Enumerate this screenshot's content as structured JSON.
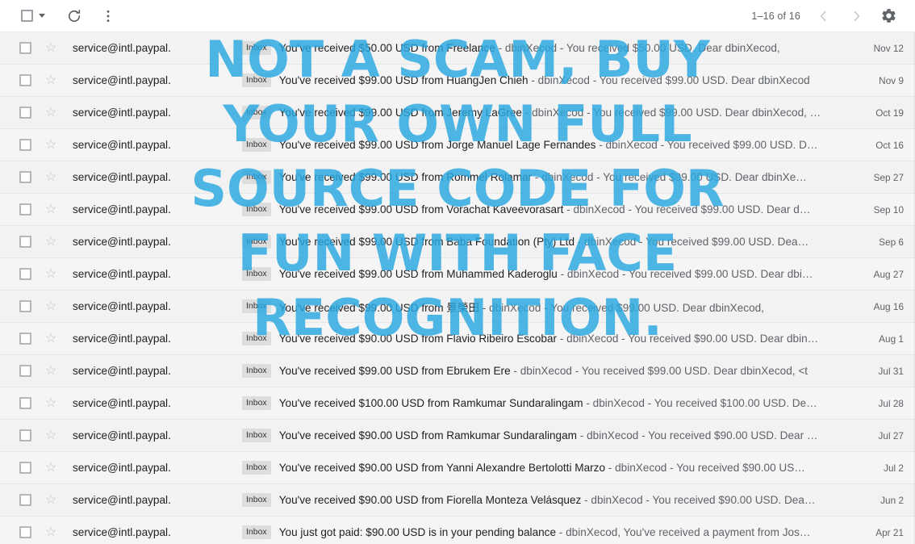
{
  "toolbar": {
    "select_all_label": "Select all",
    "select_all_dropdown_label": "Selection options",
    "refresh_label": "Refresh",
    "more_label": "More",
    "count_text": "1–16 of 16",
    "newer_label": "Newer",
    "older_label": "Older",
    "settings_label": "Settings"
  },
  "watermark": {
    "color": "#29a8e0",
    "lines": [
      "NOT A SCAM, BUY",
      "YOUR OWN FULL",
      "SOURCE CODE FOR",
      "FUN WITH FACE",
      "RECOGNITION."
    ]
  },
  "mail": {
    "label_chip": "Inbox",
    "sender": "service@intl.paypal.",
    "rows": [
      {
        "sender": "service@intl.paypal.",
        "label": "Inbox",
        "subject": "You've received $50.00 USD from Freelance",
        "snippet": " - dbinXecod - You received $50.00 USD. Dear dbinXecod,",
        "date": "Nov 12"
      },
      {
        "sender": "service@intl.paypal.",
        "label": "Inbox",
        "subject": "You've received $99.00 USD from HuangJen Chieh",
        "snippet": " - dbinXecod - You received $99.00 USD. Dear dbinXecod",
        "date": "Nov 9"
      },
      {
        "sender": "service@intl.paypal.",
        "label": "Inbox",
        "subject": "You've received $99.00 USD from Jeremy LaGree",
        "snippet": " - dbinXecod - You received $99.00 USD. Dear dbinXecod, …",
        "date": "Oct 19"
      },
      {
        "sender": "service@intl.paypal.",
        "label": "Inbox",
        "subject": "You've received $99.00 USD from Jorge Manuel Lage Fernandes",
        "snippet": " - dbinXecod - You received $99.00 USD. D…",
        "date": "Oct 16"
      },
      {
        "sender": "service@intl.paypal.",
        "label": "Inbox",
        "subject": "You've received $99.00 USD from Rommel Rolamar",
        "snippet": " - dbinXecod - You received $99.00 USD. Dear dbinXe…",
        "date": "Sep 27"
      },
      {
        "sender": "service@intl.paypal.",
        "label": "Inbox",
        "subject": "You've received $99.00 USD from Vorachat Kaveevorasart",
        "snippet": " - dbinXecod - You received $99.00 USD. Dear d…",
        "date": "Sep 10"
      },
      {
        "sender": "service@intl.paypal.",
        "label": "Inbox",
        "subject": "You've received $99.00 USD from Baba Foundation (Pty) Ltd",
        "snippet": " - dbinXecod - You received $99.00 USD. Dea…",
        "date": "Sep 6"
      },
      {
        "sender": "service@intl.paypal.",
        "label": "Inbox",
        "subject": "You've received $99.00 USD from Muhammed Kaderoglu",
        "snippet": " - dbinXecod - You received $99.00 USD. Dear dbi…",
        "date": "Aug 27"
      },
      {
        "sender": "service@intl.paypal.",
        "label": "Inbox",
        "subject": "You've received $99.00 USD from 景榮田",
        "snippet": " - dbinXecod - You received $99.00 USD. Dear dbinXecod,",
        "date": "Aug 16"
      },
      {
        "sender": "service@intl.paypal.",
        "label": "Inbox",
        "subject": "You've received $90.00 USD from Flavio Ribeiro Escobar",
        "snippet": " - dbinXecod - You received $90.00 USD. Dear dbin…",
        "date": "Aug 1"
      },
      {
        "sender": "service@intl.paypal.",
        "label": "Inbox",
        "subject": "You've received $99.00 USD from Ebrukem Ere",
        "snippet": " - dbinXecod - You received $99.00 USD. Dear dbinXecod, <t",
        "date": "Jul 31"
      },
      {
        "sender": "service@intl.paypal.",
        "label": "Inbox",
        "subject": "You've received $100.00 USD from Ramkumar Sundaralingam",
        "snippet": " - dbinXecod - You received $100.00 USD. De…",
        "date": "Jul 28"
      },
      {
        "sender": "service@intl.paypal.",
        "label": "Inbox",
        "subject": "You've received $90.00 USD from Ramkumar Sundaralingam",
        "snippet": " - dbinXecod - You received $90.00 USD. Dear …",
        "date": "Jul 27"
      },
      {
        "sender": "service@intl.paypal.",
        "label": "Inbox",
        "subject": "You've received $90.00 USD from Yanni Alexandre Bertolotti Marzo",
        "snippet": " - dbinXecod - You received $90.00 US…",
        "date": "Jul 2"
      },
      {
        "sender": "service@intl.paypal.",
        "label": "Inbox",
        "subject": "You've received $90.00 USD from Fiorella Monteza Velásquez",
        "snippet": " - dbinXecod - You received $90.00 USD. Dea…",
        "date": "Jun 2"
      },
      {
        "sender": "service@intl.paypal.",
        "label": "Inbox",
        "subject": "You just got paid: $90.00 USD is in your pending balance",
        "snippet": " - dbinXecod, You've received a payment from Jos…",
        "date": "Apr 21"
      }
    ]
  }
}
